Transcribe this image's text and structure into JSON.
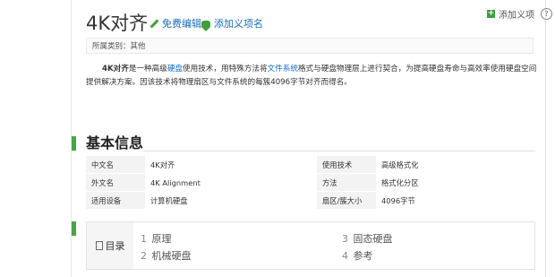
{
  "title": "4K对齐",
  "actions": {
    "edit": "免费编辑",
    "add_sense": "添加义项名"
  },
  "top_right": {
    "add_sense": "添加义项",
    "help": "?"
  },
  "category": "所属类别：其他",
  "intro": {
    "bold": "4K对齐",
    "part1": "是一种高级",
    "link1": "硬盘",
    "part2": "使用技术，用特殊方法将",
    "link2": "文件系统",
    "part3": "格式与硬盘物理层上进行契合，为提高硬盘寿命与高效率使用硬盘空间提供解决方案。因该技术将物理扇区与文件系统的每簇4096字节对齐而得名。"
  },
  "basic_info": {
    "title": "基本信息",
    "rows": [
      {
        "k1": "中文名",
        "v1": "4K对齐",
        "k2": "使用技术",
        "v2": "高级格式化"
      },
      {
        "k1": "外文名",
        "v1": "4K Alignment",
        "k2": "方法",
        "v2": "格式化分区"
      },
      {
        "k1": "适用设备",
        "v1": "计算机硬盘",
        "k2": "扇区/簇大小",
        "v2": "4096字节"
      }
    ]
  },
  "toc": {
    "label": "目录",
    "items": [
      {
        "num": "1",
        "text": "原理"
      },
      {
        "num": "2",
        "text": "机械硬盘"
      },
      {
        "num": "3",
        "text": "固态硬盘"
      },
      {
        "num": "4",
        "text": "参考"
      }
    ]
  },
  "colors": {
    "accent_green": "#4aa34a",
    "link_blue": "#136ec2"
  }
}
